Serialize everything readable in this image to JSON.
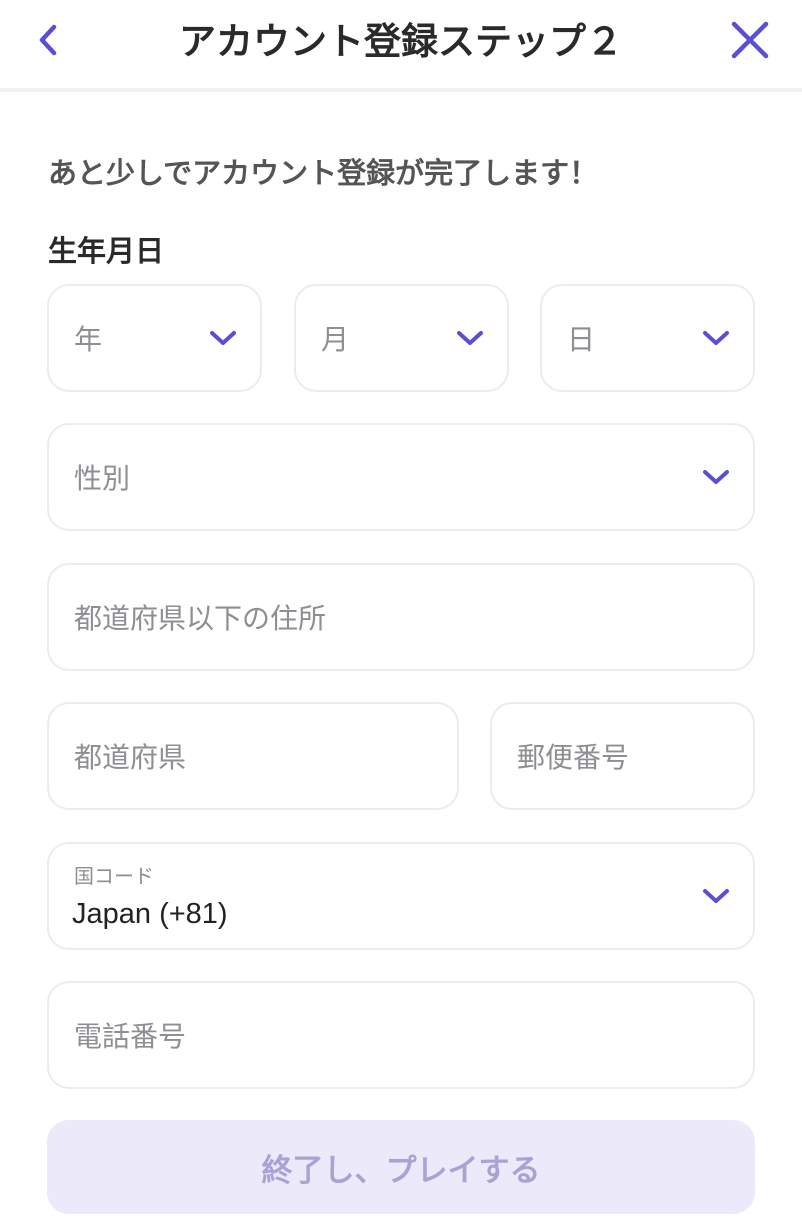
{
  "header": {
    "title": "アカウント登録ステップ２",
    "back_icon": "chevron-left-icon",
    "close_icon": "close-icon"
  },
  "intro": "あと少しでアカウント登録が完了します！",
  "birthdate": {
    "label": "生年月日",
    "year_placeholder": "年",
    "month_placeholder": "月",
    "day_placeholder": "日"
  },
  "gender": {
    "placeholder": "性別"
  },
  "address": {
    "placeholder": "都道府県以下の住所"
  },
  "prefecture": {
    "placeholder": "都道府県"
  },
  "postal_code": {
    "placeholder": "郵便番号"
  },
  "country_code": {
    "label": "国コード",
    "value": "Japan (+81)"
  },
  "phone": {
    "placeholder": "電話番号"
  },
  "submit": {
    "label": "終了し、プレイする",
    "state": "disabled"
  },
  "colors": {
    "accent": "#5b4fd1",
    "field_border": "#ececef",
    "placeholder": "#8e8e93",
    "submit_bg_disabled": "#ebe9fa",
    "submit_text_disabled": "#a8a3d4"
  }
}
